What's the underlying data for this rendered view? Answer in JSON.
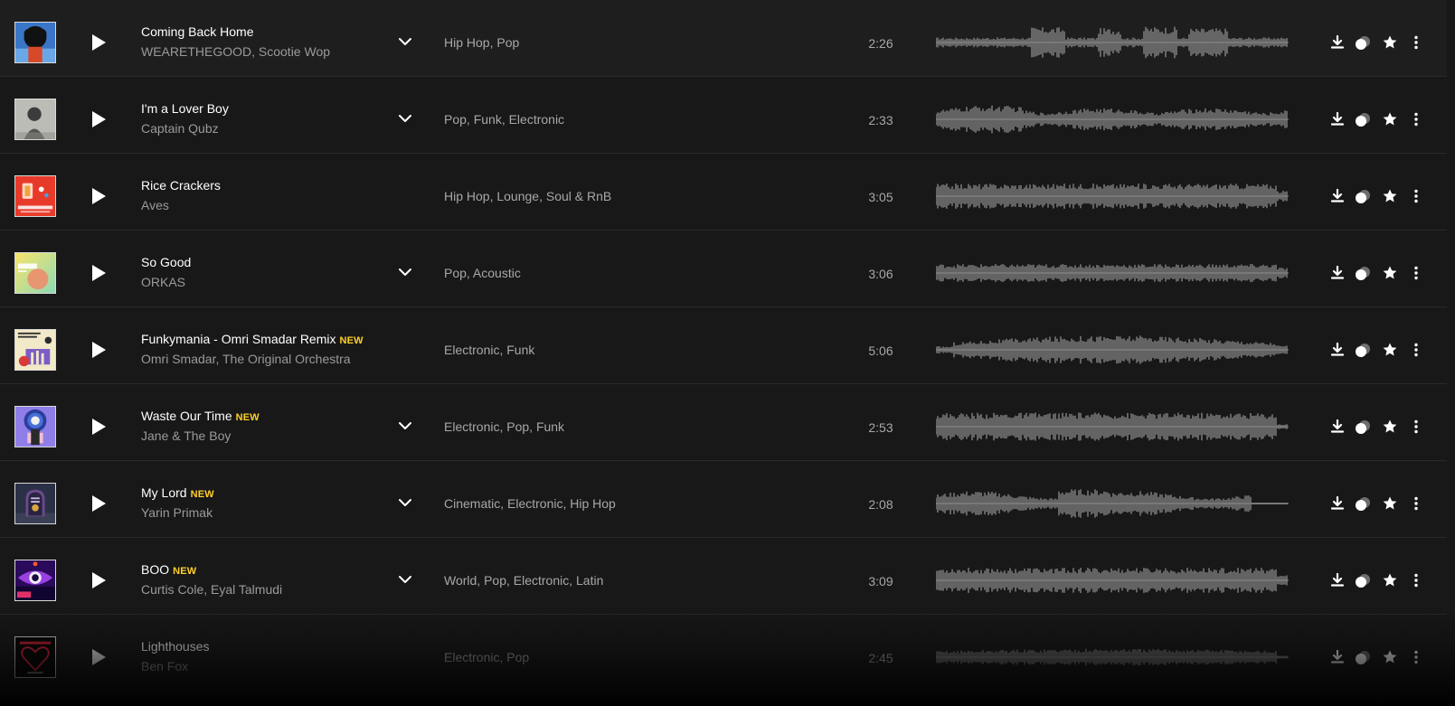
{
  "tracks": [
    {
      "title": "Coming Back Home",
      "artists": "WEARETHEGOOD, Scootie Wop",
      "genres": "Hip Hop,  Pop",
      "duration": "2:26",
      "is_new": false,
      "new_label": "",
      "has_expand": true,
      "cover_colors": [
        "#3a76c8",
        "#6aa7e6",
        "#111111"
      ],
      "cover_art": "afro-portrait",
      "waveform_profile": "sections"
    },
    {
      "title": "I'm a Lover Boy",
      "artists": "Captain Qubz",
      "genres": "Pop,  Funk,  Electronic",
      "duration": "2:33",
      "is_new": false,
      "new_label": "",
      "has_expand": true,
      "cover_colors": [
        "#8a8a86",
        "#d8d8d2",
        "#3c3c3c"
      ],
      "cover_art": "bw-child-photo",
      "waveform_profile": "wavy"
    },
    {
      "title": "Rice Crackers",
      "artists": "Aves",
      "genres": "Hip Hop,  Lounge,  Soul & RnB",
      "duration": "3:05",
      "is_new": false,
      "new_label": "",
      "has_expand": false,
      "cover_colors": [
        "#e83a2a",
        "#ffd9c8",
        "#ffffff"
      ],
      "cover_art": "red-packaging",
      "waveform_profile": "dense"
    },
    {
      "title": "So Good",
      "artists": "ORKAS",
      "genres": "Pop,  Acoustic",
      "duration": "3:06",
      "is_new": false,
      "new_label": "",
      "has_expand": true,
      "cover_colors": [
        "#f7e36a",
        "#f08a6a",
        "#ffffff"
      ],
      "cover_art": "gradient-text",
      "waveform_profile": "steady"
    },
    {
      "title": "Funkymania - Omri Smadar Remix",
      "artists": "Omri Smadar, The Original Orchestra",
      "genres": "Electronic,  Funk",
      "duration": "5:06",
      "is_new": true,
      "new_label": "NEW",
      "has_expand": false,
      "cover_colors": [
        "#f2e9c8",
        "#7a5dc8",
        "#d83a3a"
      ],
      "cover_art": "retro-collage",
      "waveform_profile": "swell"
    },
    {
      "title": "Waste Our Time",
      "artists": "Jane & The Boy",
      "genres": "Electronic,  Pop,  Funk",
      "duration": "2:53",
      "is_new": true,
      "new_label": "NEW",
      "has_expand": true,
      "cover_colors": [
        "#8f7ee8",
        "#2a3f9a",
        "#f0f0f0"
      ],
      "cover_art": "cosmic-figure",
      "waveform_profile": "loud"
    },
    {
      "title": "My Lord",
      "artists": "Yarin Primak",
      "genres": "Cinematic,  Electronic,  Hip Hop",
      "duration": "2:08",
      "is_new": true,
      "new_label": "NEW",
      "has_expand": true,
      "cover_colors": [
        "#2a3046",
        "#6b4a8a",
        "#c8b8e0"
      ],
      "cover_art": "tombstone",
      "waveform_profile": "tail"
    },
    {
      "title": "BOO",
      "artists": "Curtis Cole, Eyal Talmudi",
      "genres": "World,  Pop,  Electronic,  Latin",
      "duration": "3:09",
      "is_new": true,
      "new_label": "NEW",
      "has_expand": true,
      "cover_colors": [
        "#2a0a5a",
        "#e0306a",
        "#9a40e0"
      ],
      "cover_art": "neon-eye",
      "waveform_profile": "dense"
    },
    {
      "title": "Lighthouses",
      "artists": "Ben Fox",
      "genres": "Electronic,  Pop",
      "duration": "2:45",
      "is_new": false,
      "new_label": "",
      "has_expand": false,
      "cover_colors": [
        "#050505",
        "#e0203a",
        "#ffffff"
      ],
      "cover_art": "neon-heart",
      "waveform_profile": "soft"
    }
  ],
  "icons": {
    "play": "play-icon",
    "expand": "chevron-down-icon",
    "download": "download-icon",
    "similar": "similar-tracks-icon",
    "favorite": "star-icon",
    "more": "more-vertical-icon"
  },
  "colors": {
    "background": "#181818",
    "divider": "#2a2a2a",
    "title": "#ffffff",
    "subtitle": "#9a9a9a",
    "new_badge": "#ffd02c",
    "waveform": "#8c8c8c"
  }
}
